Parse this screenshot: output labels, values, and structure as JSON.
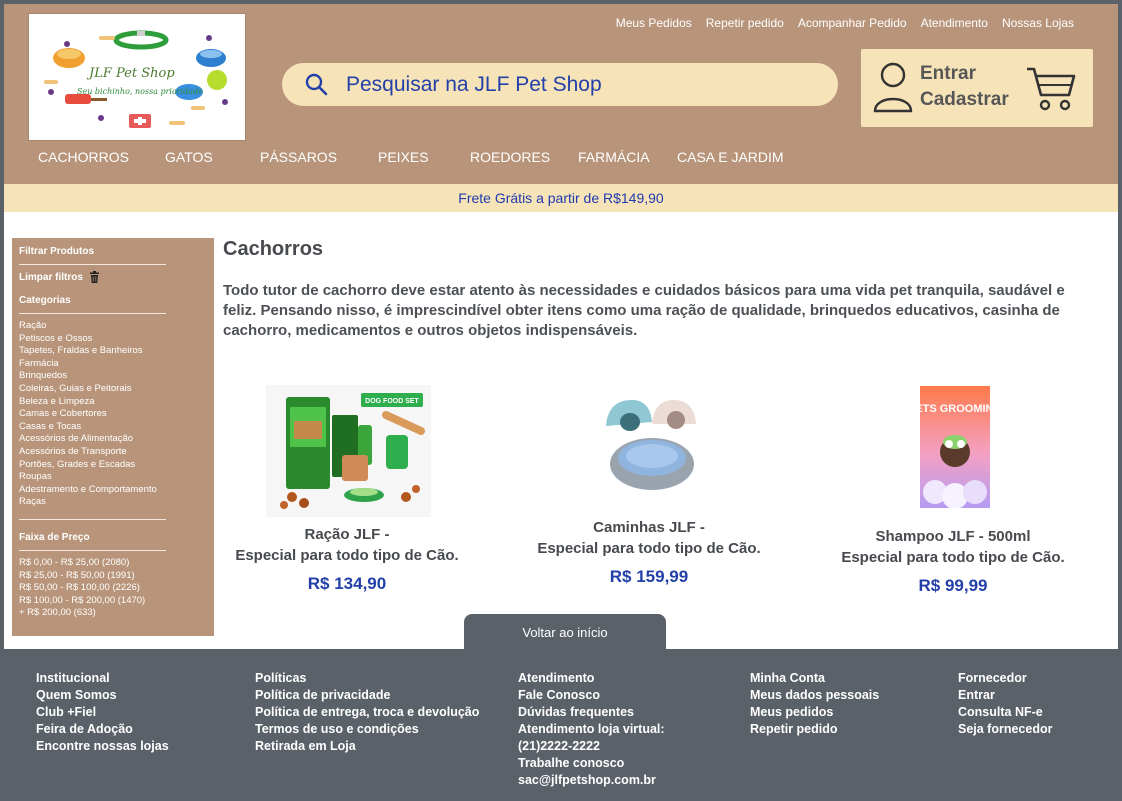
{
  "logo": {
    "title": "JLF Pet Shop",
    "subtitle": "Seu bichinho, nossa prioridade"
  },
  "top_links": [
    "Meus Pedidos",
    "Repetir pedido",
    "Acompanhar Pedido",
    "Atendimento",
    "Nossas Lojas"
  ],
  "search": {
    "placeholder": "Pesquisar na JLF Pet Shop",
    "icon": "search-icon"
  },
  "account": {
    "login_label": "Entrar",
    "register_label": "Cadastrar",
    "user_icon": "user-icon",
    "cart_icon": "cart-icon"
  },
  "nav": [
    "CACHORROS",
    "GATOS",
    "PÁSSAROS",
    "PEIXES",
    "ROEDORES",
    "FARMÁCIA",
    "CASA E JARDIM"
  ],
  "banner": "Frete Grátis a partir de R$149,90",
  "sidebar": {
    "filter_title": "Filtrar Produtos",
    "clear_filters": "Limpar filtros",
    "categories_title": "Categorias",
    "categories": [
      "Ração",
      "Petiscos e Ossos",
      "Tapetes, Fraldas e Banheiros",
      "Farmácia",
      "Brinquedos",
      "Coleiras, Guias e Peitorais",
      "Beleza e Limpeza",
      "Camas e Cobertores",
      "Casas e Tocas",
      "Acessórios de Alimentação",
      "Acessórios de Transporte",
      "Portões, Grades e Escadas",
      "Roupas",
      "Adestramento e Comportamento",
      "Raças"
    ],
    "price_title": "Faixa de Preço",
    "price_ranges": [
      "R$ 0,00 - R$ 25,00 (2080)",
      "R$ 25,00 - R$ 50,00 (1991)",
      "R$ 50,00 - R$ 100,00 (2226)",
      "R$ 100,00 - R$ 200,00 (1470)",
      "+ R$ 200,00 (633)"
    ]
  },
  "main": {
    "title": "Cachorros",
    "intro": "Todo tutor de cachorro deve estar atento às necessidades e cuidados básicos para uma vida pet tranquila, saudável e feliz. Pensando nisso, é imprescindível obter itens como uma ração de qualidade, brinquedos educativos, casinha de cachorro, medicamentos e outros objetos indispensáveis."
  },
  "products": [
    {
      "name": "Ração JLF -",
      "subtitle": "Especial para todo tipo de Cão.",
      "price": "R$ 134,90",
      "image_label": "DOG FOOD SET"
    },
    {
      "name": "Caminhas JLF -",
      "subtitle": "Especial para todo tipo de Cão.",
      "price": "R$ 159,99"
    },
    {
      "name": "Shampoo JLF - 500ml",
      "subtitle": "Especial para todo tipo de Cão.",
      "price": "R$ 99,99",
      "image_label": "PETS GROOMING"
    }
  ],
  "back_to_top": "Voltar ao início",
  "footer": {
    "col1": [
      "Institucional",
      "Quem Somos",
      "Club +Fiel",
      "Feira de Adoção",
      "Encontre nossas lojas"
    ],
    "col2": [
      "Políticas",
      "Política de privacidade",
      "Política de entrega, troca e devolução",
      "Termos de uso e condições",
      "Retirada em Loja"
    ],
    "col3": [
      "Atendimento",
      "Fale Conosco",
      "Dúvidas frequentes",
      "Atendimento loja virtual:",
      "(21)2222-2222",
      "Trabalhe conosco",
      "sac@jlfpetshop.com.br"
    ],
    "col4": [
      "Minha Conta",
      "Meus dados pessoais",
      "Meus pedidos",
      "Repetir pedido"
    ],
    "col5": [
      "Fornecedor",
      "Entrar",
      "Consulta NF-e",
      "Seja fornecedor"
    ]
  },
  "colors": {
    "header": "#b8957a",
    "banner": "#f6e3b7",
    "accent_blue": "#2340a8",
    "footer": "#5b6169"
  }
}
